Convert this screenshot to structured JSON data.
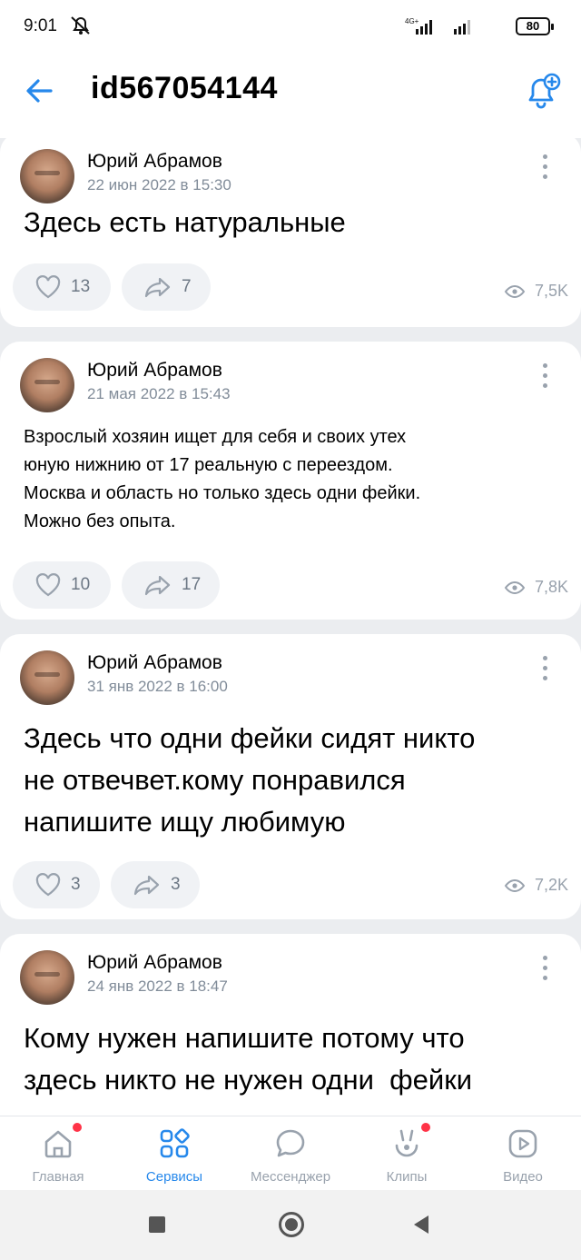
{
  "status_bar": {
    "time": "9:01",
    "network": "4G+",
    "battery": "80"
  },
  "header": {
    "title": "id567054144",
    "back_icon": "arrow-left-icon",
    "subscribe_icon": "bell-plus-icon"
  },
  "posts": [
    {
      "author": "Юрий Абрамов",
      "date": "22 июн 2022 в 15:30",
      "text": "Здесь есть натуральные",
      "likes": "13",
      "shares": "7",
      "views": "7,5K"
    },
    {
      "author": "Юрий Абрамов",
      "date": "21 мая 2022 в 15:43",
      "text_lines": [
        "Взрослый хозяин ищет для себя и своих утех",
        "юную нижнию от 17 реальную с переездом.",
        "Москва и область но только здесь одни фейки.",
        "Можно без опыта."
      ],
      "likes": "10",
      "shares": "17",
      "views": "7,8K"
    },
    {
      "author": "Юрий Абрамов",
      "date": "31 янв 2022 в 16:00",
      "text_lines": [
        "Здесь что одни фейки сидят никто",
        "не отвечвет.кому понравился",
        "напишите ищу любимую"
      ],
      "likes": "3",
      "shares": "3",
      "views": "7,2K"
    },
    {
      "author": "Юрий Абрамов",
      "date": "24 янв 2022 в 18:47",
      "text_lines": [
        "Кому нужен напишите потому что",
        "здесь никто не нужен одни  фейки"
      ]
    }
  ],
  "tabbar": {
    "items": [
      {
        "label": "Главная",
        "icon": "home-icon",
        "badge": true
      },
      {
        "label": "Сервисы",
        "icon": "services-grid-icon",
        "active": true
      },
      {
        "label": "Мессенджер",
        "icon": "message-bubble-icon"
      },
      {
        "label": "Клипы",
        "icon": "clips-icon",
        "badge": true
      },
      {
        "label": "Видео",
        "icon": "video-play-icon"
      }
    ],
    "accent_color": "#2688eb",
    "badge_color": "#ff3347"
  }
}
